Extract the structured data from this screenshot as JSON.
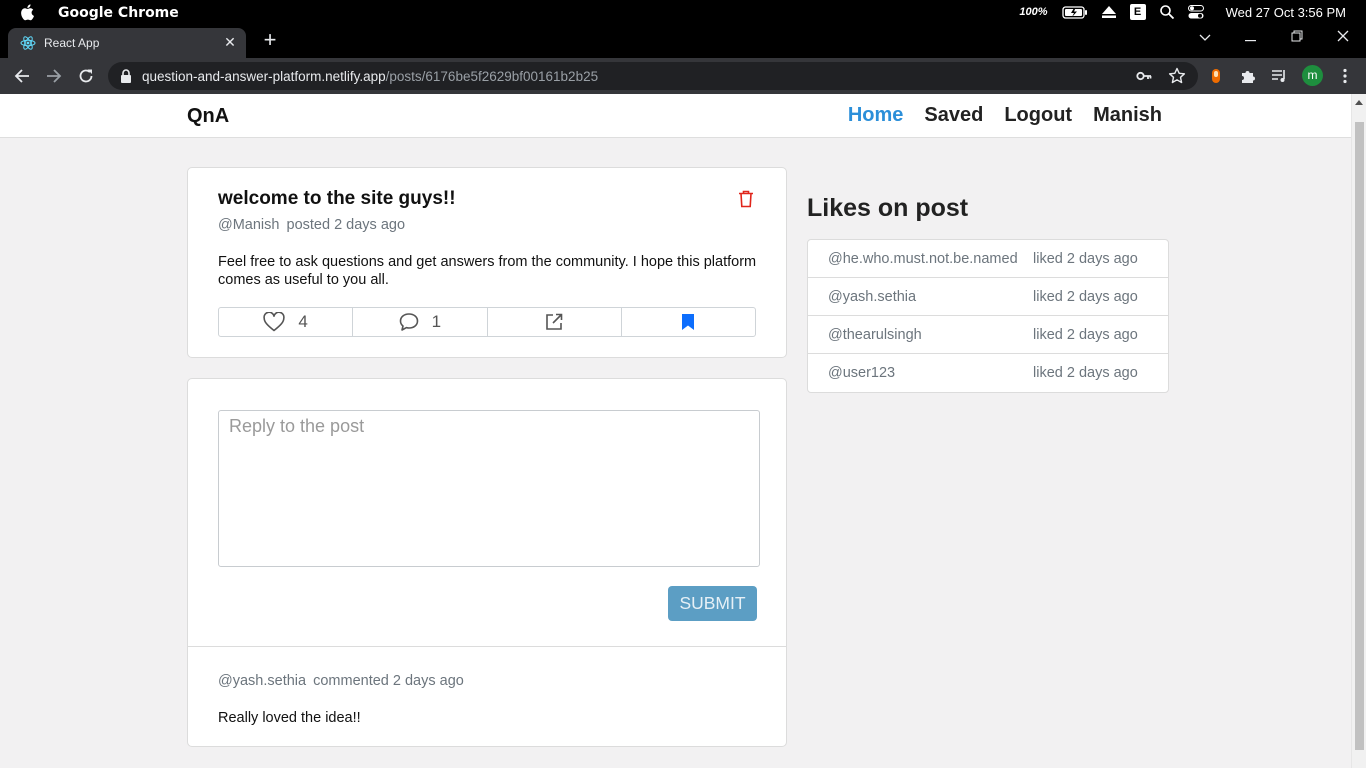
{
  "menubar": {
    "app_name": "Google Chrome",
    "battery_percent": "100%",
    "input_source": "E",
    "clock": "Wed 27 Oct  3:56 PM"
  },
  "browser": {
    "tab_title": "React App",
    "url_host": "question-and-answer-platform.netlify.app",
    "url_path": "/posts/6176be5f2629bf00161b2b25",
    "profile_initial": "m"
  },
  "navbar": {
    "brand": "QnA",
    "links": [
      "Home",
      "Saved",
      "Logout",
      "Manish"
    ],
    "active_link": "Home"
  },
  "post": {
    "title": "welcome to the site guys!!",
    "author": "@Manish",
    "posted": "posted 2 days ago",
    "body": "Feel free to ask questions and get answers from the community. I hope this platform comes as useful to you all.",
    "likes": "4",
    "comments": "1"
  },
  "reply": {
    "placeholder": "Reply to the post",
    "submit_label": "SUBMIT"
  },
  "comment": {
    "author": "@yash.sethia",
    "when": "commented 2 days ago",
    "body": "Really loved the idea!!"
  },
  "likes_panel": {
    "heading": "Likes on post",
    "items": [
      {
        "user": "@he.who.must.not.be.named",
        "when": "liked 2 days ago"
      },
      {
        "user": "@yash.sethia",
        "when": "liked 2 days ago"
      },
      {
        "user": "@thearulsingh",
        "when": "liked 2 days ago"
      },
      {
        "user": "@user123",
        "when": "liked 2 days ago"
      }
    ]
  },
  "colors": {
    "accent": "#2c8fd9",
    "submit": "#5c9ec4",
    "bookmark": "#0d6efd",
    "delete": "#e0251b"
  },
  "icons": [
    "apple-icon",
    "battery-icon",
    "eject-icon",
    "search-icon",
    "control-center-icon",
    "react-favicon",
    "close-icon",
    "plus-icon",
    "chevron-down-icon",
    "minimize-icon",
    "restore-icon",
    "back-icon",
    "forward-icon",
    "reload-icon",
    "lock-icon",
    "key-icon",
    "star-icon",
    "extension-icon",
    "puzzle-icon",
    "media-icon",
    "more-icon",
    "trash-icon",
    "heart-icon",
    "comment-icon",
    "share-icon",
    "bookmark-icon"
  ]
}
